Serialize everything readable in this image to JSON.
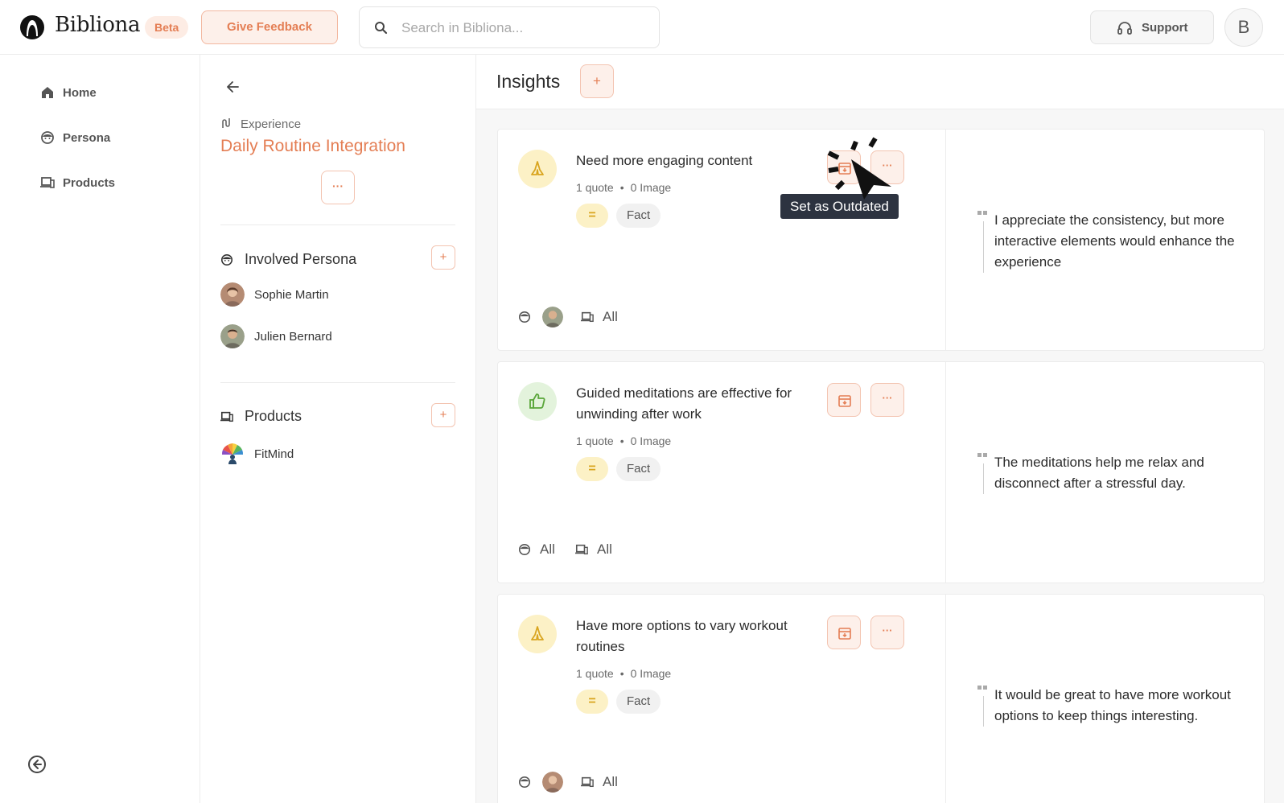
{
  "header": {
    "brand": "Bibliona",
    "beta": "Beta",
    "feedback": "Give Feedback",
    "search_placeholder": "Search in Bibliona...",
    "support": "Support",
    "avatar_initial": "B"
  },
  "nav": {
    "items": [
      {
        "label": "Home",
        "icon": "home-icon"
      },
      {
        "label": "Persona",
        "icon": "persona-icon"
      },
      {
        "label": "Products",
        "icon": "devices-icon"
      }
    ]
  },
  "experience": {
    "kind": "Experience",
    "title": "Daily Routine Integration",
    "more": "···",
    "persona_section": "Involved Persona",
    "personas": [
      "Sophie Martin",
      "Julien Bernard"
    ],
    "products_section": "Products",
    "products": [
      "FitMind"
    ]
  },
  "insights": {
    "title": "Insights",
    "add": "+",
    "cards": [
      {
        "kind": "need",
        "title": "Need more engaging content",
        "quotes": "1 quote",
        "images": "0 Image",
        "eq": "=",
        "tag": "Fact",
        "persona_all": "",
        "product_all": "All",
        "quote": "I appreciate the consistency, but more interactive elements would enhance the experience"
      },
      {
        "kind": "like",
        "title": "Guided meditations are effective for unwinding after work",
        "quotes": "1 quote",
        "images": "0 Image",
        "eq": "=",
        "tag": "Fact",
        "persona_all": "All",
        "product_all": "All",
        "quote": "The meditations help me relax and disconnect after a stressful day."
      },
      {
        "kind": "need",
        "title": "Have more options to vary workout routines",
        "quotes": "1 quote",
        "images": "0 Image",
        "eq": "=",
        "tag": "Fact",
        "persona_all": "",
        "product_all": "All",
        "quote": "It would be great to have more workout options to keep things interesting."
      }
    ],
    "more": "···",
    "tooltip": "Set as Outdated"
  },
  "colors": {
    "accent": "#e47e54",
    "accent_bg": "#fdf0ea",
    "need_bg": "#fcf1c6",
    "like_bg": "#e3f3dc",
    "tooltip_bg": "#2d3340"
  }
}
